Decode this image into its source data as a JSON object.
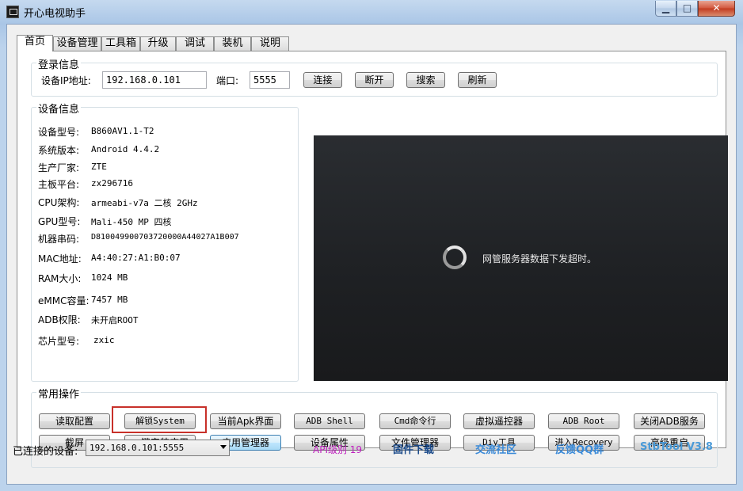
{
  "window": {
    "title": "开心电视助手"
  },
  "tabs": [
    {
      "label": "首页",
      "active": true
    },
    {
      "label": "设备管理"
    },
    {
      "label": "工具箱"
    },
    {
      "label": "升级"
    },
    {
      "label": "调试"
    },
    {
      "label": "装机"
    },
    {
      "label": "说明"
    }
  ],
  "login": {
    "legend": "登录信息",
    "ip_label": "设备IP地址:",
    "ip_value": "192.168.0.101",
    "port_label": "端口:",
    "port_value": "5555",
    "buttons": [
      "连接",
      "断开",
      "搜索",
      "刷新"
    ]
  },
  "device": {
    "legend": "设备信息",
    "rows": [
      {
        "label": "设备型号:",
        "value": "B860AV1.1-T2"
      },
      {
        "label": "系统版本:",
        "value": "Android 4.4.2"
      },
      {
        "label": "生产厂家:",
        "value": "ZTE"
      },
      {
        "label": "主板平台:",
        "value": "zx296716"
      },
      {
        "label": "CPU架构:",
        "value": "armeabi-v7a 二核 2GHz"
      },
      {
        "label": "GPU型号:",
        "value": "Mali-450 MP 四核"
      },
      {
        "label": "机器串码:",
        "value": "D810049900703720000A44027A1B007"
      },
      {
        "label": "MAC地址:",
        "value": "A4:40:27:A1:B0:07"
      },
      {
        "label": "RAM大小:",
        "value": "1024 MB"
      },
      {
        "label": "eMMC容量:",
        "value": "7457 MB"
      },
      {
        "label": "ADB权限:",
        "value": "未开启ROOT"
      },
      {
        "label": "芯片型号:",
        "value": "zxic"
      }
    ]
  },
  "screen": {
    "message": "网管服务器数据下发超时。"
  },
  "ops": {
    "legend": "常用操作",
    "row1": [
      "读取配置",
      "解锁System",
      "当前Apk界面",
      "ADB Shell",
      "Cmd命令行",
      "虚拟遥控器",
      "ADB  Root",
      "关闭ADB服务"
    ],
    "row2": [
      "截屏",
      "一键安装应用",
      "应用管理器",
      "设备属性",
      "文件管理器",
      "Diy工具",
      "进入Recovery",
      "高级重启"
    ]
  },
  "status": {
    "connected_label": "已连接的设备:",
    "connected_value": "192.168.0.101:5555",
    "api_level": "API级别 19",
    "links": [
      "固件下载",
      "交流社区",
      "反馈QQ群",
      "StbTool V3.8"
    ]
  },
  "colors": {
    "api": "#c020c0",
    "firmware": "#1a4a8a",
    "community": "#3a8ad8",
    "feedback": "#3a8ad8",
    "version": "#4a9ad8",
    "highlight": "#c8312a"
  }
}
